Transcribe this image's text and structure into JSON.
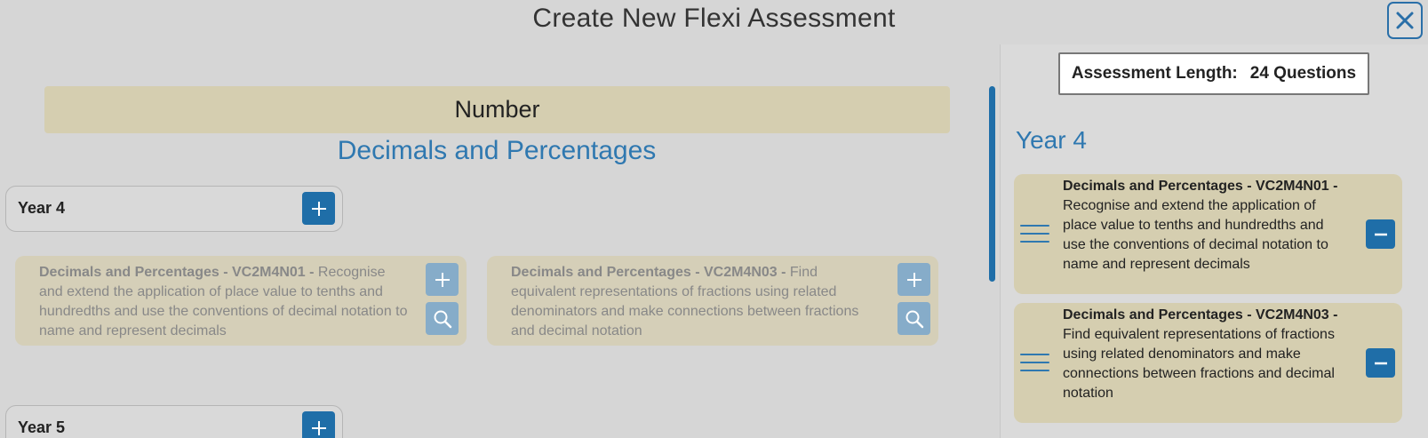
{
  "dialog": {
    "title": "Create New Flexi Assessment"
  },
  "left": {
    "strand": "Number",
    "substrand": "Decimals and Percentages",
    "years": [
      {
        "label": "Year 4",
        "cards": [
          {
            "title": "Decimals and Percentages - VC2M4N01 - ",
            "desc": "Recognise and extend the application of place value to tenths and hundredths and use the conventions of decimal notation to name and represent decimals"
          },
          {
            "title": "Decimals and Percentages - VC2M4N03 - ",
            "desc": "Find equivalent representations of fractions using related denominators and make connections between fractions and decimal notation"
          }
        ]
      },
      {
        "label": "Year 5"
      }
    ]
  },
  "right": {
    "assessment_length_label": "Assessment Length:",
    "assessment_length_value": "24 Questions",
    "year_heading": "Year 4",
    "selected": [
      {
        "title": "Decimals and Percentages - VC2M4N01 - ",
        "desc": "Recognise and extend the application of place value to tenths and hundredths and use the conventions of decimal notation to name and represent decimals"
      },
      {
        "title": "Decimals and Percentages - VC2M4N03 - ",
        "desc": "Find equivalent representations of fractions using related denominators and make connections between fractions and decimal notation"
      }
    ]
  },
  "colors": {
    "accent": "#1f6ea8",
    "heading_blue": "#2f78b0",
    "strand_bg": "#d5ceb0",
    "disabled_btn": "#86acc9"
  },
  "icons": {
    "close": "close-icon",
    "add": "plus-icon",
    "preview": "search-icon",
    "drag": "drag-handle-icon",
    "remove": "minus-icon"
  }
}
